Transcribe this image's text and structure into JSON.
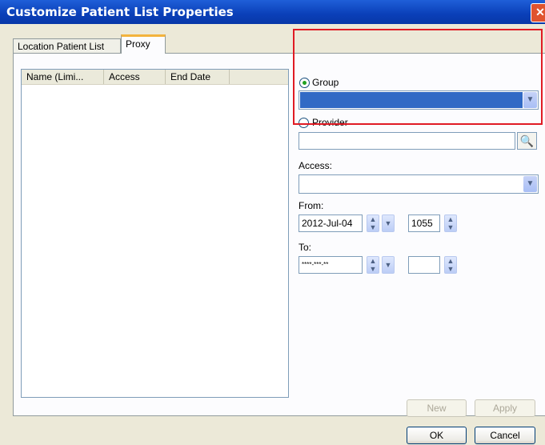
{
  "window": {
    "title": "Customize Patient List Properties",
    "close_glyph": "✕"
  },
  "tabs": [
    {
      "label": "Location Patient List",
      "active": false
    },
    {
      "label": "Proxy",
      "active": true
    }
  ],
  "list": {
    "columns": [
      "Name (Limi...",
      "Access",
      "End Date"
    ]
  },
  "form": {
    "group_label": "Group",
    "group_selected": true,
    "provider_label": "Provider",
    "provider_selected": false,
    "provider_value": "",
    "access_label": "Access:",
    "access_value": "",
    "from_label": "From:",
    "from_date": "2012-Jul-04",
    "from_time": "1055",
    "to_label": "To:",
    "to_date": "****-***-**",
    "to_time": ""
  },
  "buttons": {
    "new": "New",
    "apply": "Apply",
    "ok": "OK",
    "cancel": "Cancel"
  },
  "icons": {
    "find": "binoculars-icon",
    "dropdown": "chevron-down-icon",
    "spin": "spin-updown-icon"
  },
  "colors": {
    "titlebar": "#0a3fb8",
    "selection": "#316ac5",
    "highlight": "#e01b24"
  }
}
